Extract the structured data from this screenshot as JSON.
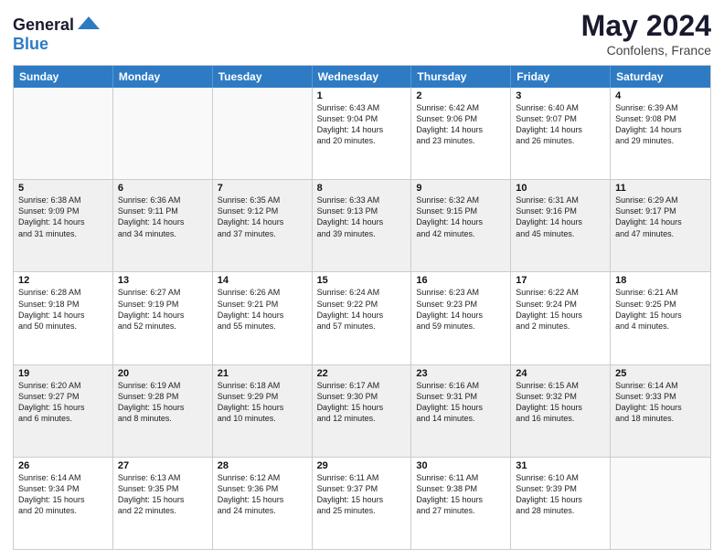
{
  "header": {
    "logo_line1": "General",
    "logo_line2": "Blue",
    "main_title": "May 2024",
    "subtitle": "Confolens, France"
  },
  "days_of_week": [
    "Sunday",
    "Monday",
    "Tuesday",
    "Wednesday",
    "Thursday",
    "Friday",
    "Saturday"
  ],
  "weeks": [
    [
      {
        "day": "",
        "lines": []
      },
      {
        "day": "",
        "lines": []
      },
      {
        "day": "",
        "lines": []
      },
      {
        "day": "1",
        "lines": [
          "Sunrise: 6:43 AM",
          "Sunset: 9:04 PM",
          "Daylight: 14 hours",
          "and 20 minutes."
        ]
      },
      {
        "day": "2",
        "lines": [
          "Sunrise: 6:42 AM",
          "Sunset: 9:06 PM",
          "Daylight: 14 hours",
          "and 23 minutes."
        ]
      },
      {
        "day": "3",
        "lines": [
          "Sunrise: 6:40 AM",
          "Sunset: 9:07 PM",
          "Daylight: 14 hours",
          "and 26 minutes."
        ]
      },
      {
        "day": "4",
        "lines": [
          "Sunrise: 6:39 AM",
          "Sunset: 9:08 PM",
          "Daylight: 14 hours",
          "and 29 minutes."
        ]
      }
    ],
    [
      {
        "day": "5",
        "lines": [
          "Sunrise: 6:38 AM",
          "Sunset: 9:09 PM",
          "Daylight: 14 hours",
          "and 31 minutes."
        ]
      },
      {
        "day": "6",
        "lines": [
          "Sunrise: 6:36 AM",
          "Sunset: 9:11 PM",
          "Daylight: 14 hours",
          "and 34 minutes."
        ]
      },
      {
        "day": "7",
        "lines": [
          "Sunrise: 6:35 AM",
          "Sunset: 9:12 PM",
          "Daylight: 14 hours",
          "and 37 minutes."
        ]
      },
      {
        "day": "8",
        "lines": [
          "Sunrise: 6:33 AM",
          "Sunset: 9:13 PM",
          "Daylight: 14 hours",
          "and 39 minutes."
        ]
      },
      {
        "day": "9",
        "lines": [
          "Sunrise: 6:32 AM",
          "Sunset: 9:15 PM",
          "Daylight: 14 hours",
          "and 42 minutes."
        ]
      },
      {
        "day": "10",
        "lines": [
          "Sunrise: 6:31 AM",
          "Sunset: 9:16 PM",
          "Daylight: 14 hours",
          "and 45 minutes."
        ]
      },
      {
        "day": "11",
        "lines": [
          "Sunrise: 6:29 AM",
          "Sunset: 9:17 PM",
          "Daylight: 14 hours",
          "and 47 minutes."
        ]
      }
    ],
    [
      {
        "day": "12",
        "lines": [
          "Sunrise: 6:28 AM",
          "Sunset: 9:18 PM",
          "Daylight: 14 hours",
          "and 50 minutes."
        ]
      },
      {
        "day": "13",
        "lines": [
          "Sunrise: 6:27 AM",
          "Sunset: 9:19 PM",
          "Daylight: 14 hours",
          "and 52 minutes."
        ]
      },
      {
        "day": "14",
        "lines": [
          "Sunrise: 6:26 AM",
          "Sunset: 9:21 PM",
          "Daylight: 14 hours",
          "and 55 minutes."
        ]
      },
      {
        "day": "15",
        "lines": [
          "Sunrise: 6:24 AM",
          "Sunset: 9:22 PM",
          "Daylight: 14 hours",
          "and 57 minutes."
        ]
      },
      {
        "day": "16",
        "lines": [
          "Sunrise: 6:23 AM",
          "Sunset: 9:23 PM",
          "Daylight: 14 hours",
          "and 59 minutes."
        ]
      },
      {
        "day": "17",
        "lines": [
          "Sunrise: 6:22 AM",
          "Sunset: 9:24 PM",
          "Daylight: 15 hours",
          "and 2 minutes."
        ]
      },
      {
        "day": "18",
        "lines": [
          "Sunrise: 6:21 AM",
          "Sunset: 9:25 PM",
          "Daylight: 15 hours",
          "and 4 minutes."
        ]
      }
    ],
    [
      {
        "day": "19",
        "lines": [
          "Sunrise: 6:20 AM",
          "Sunset: 9:27 PM",
          "Daylight: 15 hours",
          "and 6 minutes."
        ]
      },
      {
        "day": "20",
        "lines": [
          "Sunrise: 6:19 AM",
          "Sunset: 9:28 PM",
          "Daylight: 15 hours",
          "and 8 minutes."
        ]
      },
      {
        "day": "21",
        "lines": [
          "Sunrise: 6:18 AM",
          "Sunset: 9:29 PM",
          "Daylight: 15 hours",
          "and 10 minutes."
        ]
      },
      {
        "day": "22",
        "lines": [
          "Sunrise: 6:17 AM",
          "Sunset: 9:30 PM",
          "Daylight: 15 hours",
          "and 12 minutes."
        ]
      },
      {
        "day": "23",
        "lines": [
          "Sunrise: 6:16 AM",
          "Sunset: 9:31 PM",
          "Daylight: 15 hours",
          "and 14 minutes."
        ]
      },
      {
        "day": "24",
        "lines": [
          "Sunrise: 6:15 AM",
          "Sunset: 9:32 PM",
          "Daylight: 15 hours",
          "and 16 minutes."
        ]
      },
      {
        "day": "25",
        "lines": [
          "Sunrise: 6:14 AM",
          "Sunset: 9:33 PM",
          "Daylight: 15 hours",
          "and 18 minutes."
        ]
      }
    ],
    [
      {
        "day": "26",
        "lines": [
          "Sunrise: 6:14 AM",
          "Sunset: 9:34 PM",
          "Daylight: 15 hours",
          "and 20 minutes."
        ]
      },
      {
        "day": "27",
        "lines": [
          "Sunrise: 6:13 AM",
          "Sunset: 9:35 PM",
          "Daylight: 15 hours",
          "and 22 minutes."
        ]
      },
      {
        "day": "28",
        "lines": [
          "Sunrise: 6:12 AM",
          "Sunset: 9:36 PM",
          "Daylight: 15 hours",
          "and 24 minutes."
        ]
      },
      {
        "day": "29",
        "lines": [
          "Sunrise: 6:11 AM",
          "Sunset: 9:37 PM",
          "Daylight: 15 hours",
          "and 25 minutes."
        ]
      },
      {
        "day": "30",
        "lines": [
          "Sunrise: 6:11 AM",
          "Sunset: 9:38 PM",
          "Daylight: 15 hours",
          "and 27 minutes."
        ]
      },
      {
        "day": "31",
        "lines": [
          "Sunrise: 6:10 AM",
          "Sunset: 9:39 PM",
          "Daylight: 15 hours",
          "and 28 minutes."
        ]
      },
      {
        "day": "",
        "lines": []
      }
    ]
  ]
}
